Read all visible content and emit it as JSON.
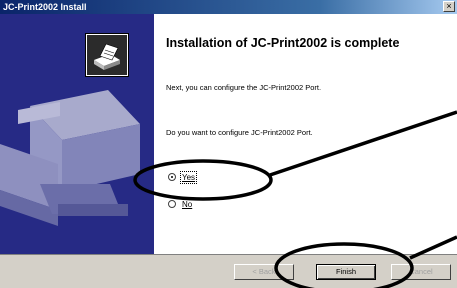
{
  "window": {
    "title": "JC-Print2002 Install",
    "close_glyph": "×"
  },
  "main": {
    "heading": "Installation of JC-Print2002 is complete",
    "line1": "Next, you can configure the JC-Print2002 Port.",
    "line2": "Do you want to configure JC-Print2002 Port.",
    "options": [
      {
        "label": "Yes",
        "checked": true
      },
      {
        "label": "No",
        "checked": false
      }
    ]
  },
  "buttons": {
    "back": "< Back",
    "finish": "Finish",
    "cancel": "Cancel"
  },
  "colors": {
    "sidebar": "#262a85",
    "titlebar": "#0a246a",
    "annotation": "#000000"
  },
  "icons": [
    "installer-logo-icon",
    "printer-illustration-icon",
    "close-icon"
  ]
}
